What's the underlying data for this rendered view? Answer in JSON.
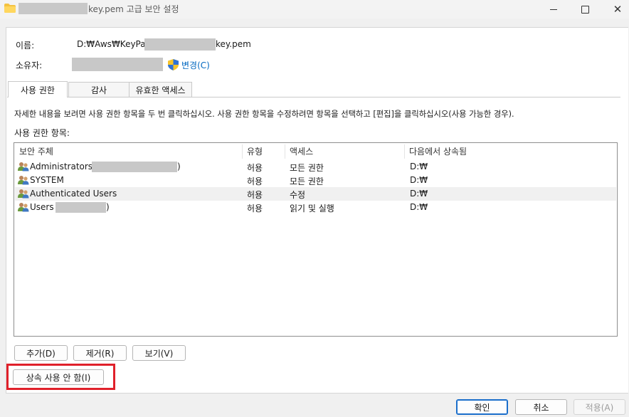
{
  "window": {
    "title_suffix": "key.pem 고급 보안 설정",
    "controls": {
      "minimize": "—",
      "maximize": "☐",
      "close": "✕"
    }
  },
  "info": {
    "name_label": "이름:",
    "name_path_prefix": "D:₩Aws₩KeyPair₩",
    "name_path_suffix": "key.pem",
    "owner_label": "소유자:",
    "change_link": "변경(C)"
  },
  "tabs": [
    {
      "label": "사용 권한",
      "active": true
    },
    {
      "label": "감사",
      "active": false
    },
    {
      "label": "유효한 액세스",
      "active": false
    }
  ],
  "instructions": "자세한 내용을 보려면 사용 권한 항목을 두 번 클릭하십시오. 사용 권한 항목을 수정하려면 항목을 선택하고 [편집]을 클릭하십시오(사용 가능한 경우).",
  "entries_label": "사용 권한 항목:",
  "columns": [
    "보안 주체",
    "유형",
    "액세스",
    "다음에서 상속됨"
  ],
  "rows": [
    {
      "principal": "Administrators (",
      "principal_end": ")",
      "type": "허용",
      "access": "모든 권한",
      "inherited": "D:₩",
      "selected": false
    },
    {
      "principal": "SYSTEM",
      "principal_end": "",
      "type": "허용",
      "access": "모든 권한",
      "inherited": "D:₩",
      "selected": false
    },
    {
      "principal": "Authenticated Users",
      "principal_end": "",
      "type": "허용",
      "access": "수정",
      "inherited": "D:₩",
      "selected": true
    },
    {
      "principal": "Users (",
      "principal_end": ")",
      "type": "허용",
      "access": "읽기 및 실행",
      "inherited": "D:₩",
      "selected": false
    }
  ],
  "buttons": {
    "add": "추가(D)",
    "remove": "제거(R)",
    "view": "보기(V)",
    "disable_inheritance": "상속 사용 안 함(I)",
    "ok": "확인",
    "cancel": "취소",
    "apply": "적용(A)"
  },
  "colors": {
    "highlight": "#e0202a",
    "link": "#0067c0",
    "accent": "#1a6ecb"
  }
}
